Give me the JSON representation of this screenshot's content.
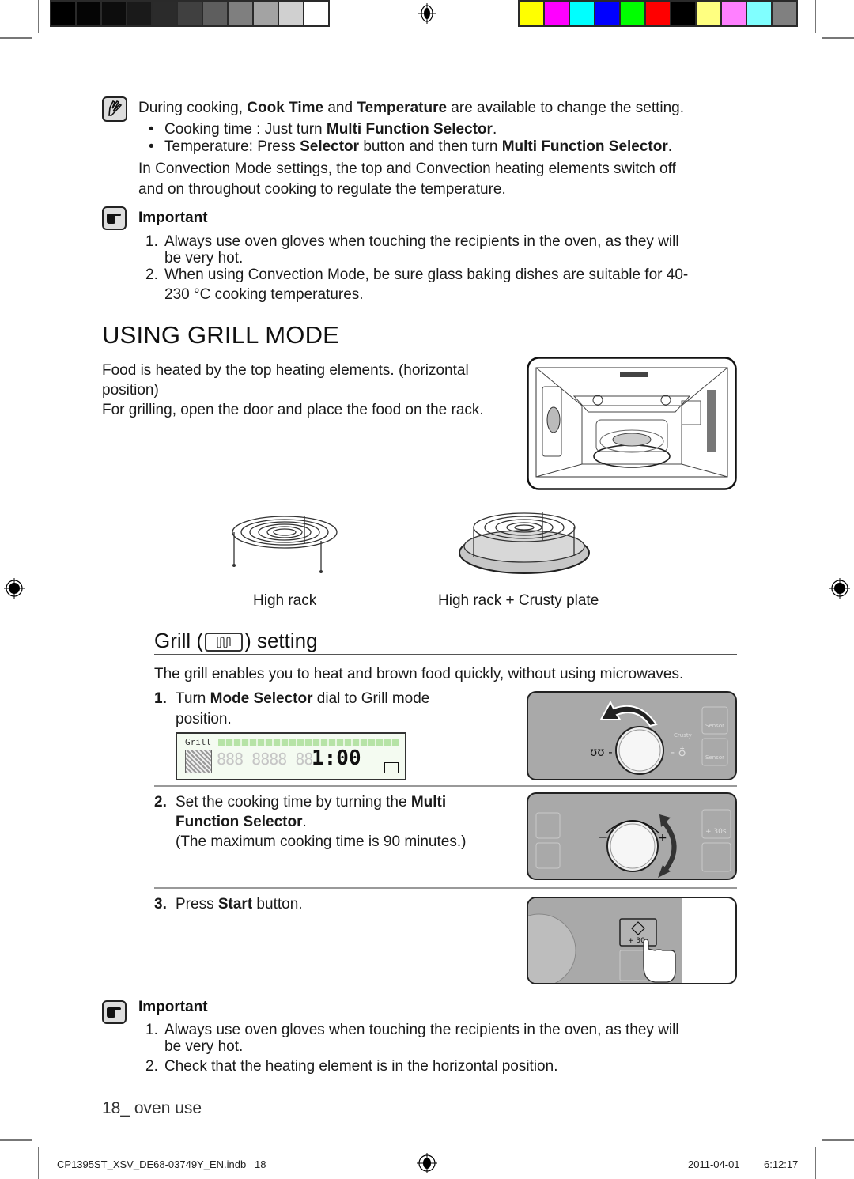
{
  "print_marks": {
    "grayscale_bars": [
      "#000000",
      "#050505",
      "#0d0d0d",
      "#1a1a1a",
      "#2b2b2b",
      "#404040",
      "#5e5e5e",
      "#7f7f7f",
      "#a3a3a3",
      "#d0d0d0",
      "#ffffff"
    ],
    "color_bars": [
      "#ffff00",
      "#ff00ff",
      "#00ffff",
      "#0000ff",
      "#00ff00",
      "#ff0000",
      "#000000",
      "#ffff80",
      "#ff80ff",
      "#80ffff",
      "#808080"
    ]
  },
  "note": {
    "intro_pre": "During cooking, ",
    "intro_b1": "Cook Time",
    "intro_mid": " and ",
    "intro_b2": "Temperature",
    "intro_post": " are available to change the setting.",
    "bullet1_pre": "Cooking time : Just turn ",
    "bullet1_b": "Multi Function Selector",
    "bullet1_post": ".",
    "bullet2_pre": "Temperature: Press ",
    "bullet2_b1": "Selector",
    "bullet2_mid": " button and then turn ",
    "bullet2_b2": "Multi Function Selector",
    "bullet2_post": ".",
    "para_line1": "In Convection Mode settings, the top and Convection heating elements switch off",
    "para_line2": "and on throughout cooking to regulate the temperature."
  },
  "important1": {
    "label": "Important",
    "item1_num": "1.",
    "item1_line1": "Always use oven gloves when touching the recipients in the oven, as they will",
    "item1_line2": "be very hot.",
    "item2_num": "2.",
    "item2_line1": "When using Convection Mode, be sure glass baking dishes are suitable for 40-",
    "item2_line2": "230 °C cooking temperatures."
  },
  "grill_mode": {
    "title": "USING GRILL MODE",
    "desc_line1": "Food is heated by the top heating elements. (horizontal",
    "desc_line2": "position)",
    "desc_line3": "For grilling, open the door and place the food on the rack.",
    "rack_label1": "High rack",
    "rack_label2": "High rack + Crusty plate"
  },
  "grill_setting": {
    "title_pre": "Grill (",
    "title_post": ") setting",
    "intro": "The grill enables you to heat and brown food quickly, without using microwaves.",
    "step1_num": "1.",
    "step1_pre": "Turn ",
    "step1_b": "Mode Selector",
    "step1_post": " dial to Grill mode",
    "step1_line2": "position.",
    "lcd_label": "Grill",
    "lcd_time": "1:00",
    "step2_num": "2.",
    "step2_pre": "Set the cooking time by turning the ",
    "step2_b1": "Multi",
    "step2_b2": "Function Selector",
    "step2_post": ".",
    "step2_note": "(The maximum cooking time is 90 minutes.)",
    "step3_num": "3.",
    "step3_pre": "Press ",
    "step3_b": "Start",
    "step3_post": " button.",
    "panel_button_label": "+ 30s",
    "panel_sensor_label": "Sensor",
    "panel_crusty_label": "Crusty"
  },
  "important2": {
    "label": "Important",
    "item1_num": "1.",
    "item1_line1": "Always use oven gloves when touching the recipients in the oven, as they will",
    "item1_line2": "be very hot.",
    "item2_num": "2.",
    "item2_line1": "Check that the heating element is in the horizontal position."
  },
  "footer": {
    "page_num": "18_",
    "section": " oven use",
    "file_name": "CP1395ST_XSV_DE68-03749Y_EN.indb   18",
    "date": "2011-04-01",
    "time": "6:12:17"
  }
}
